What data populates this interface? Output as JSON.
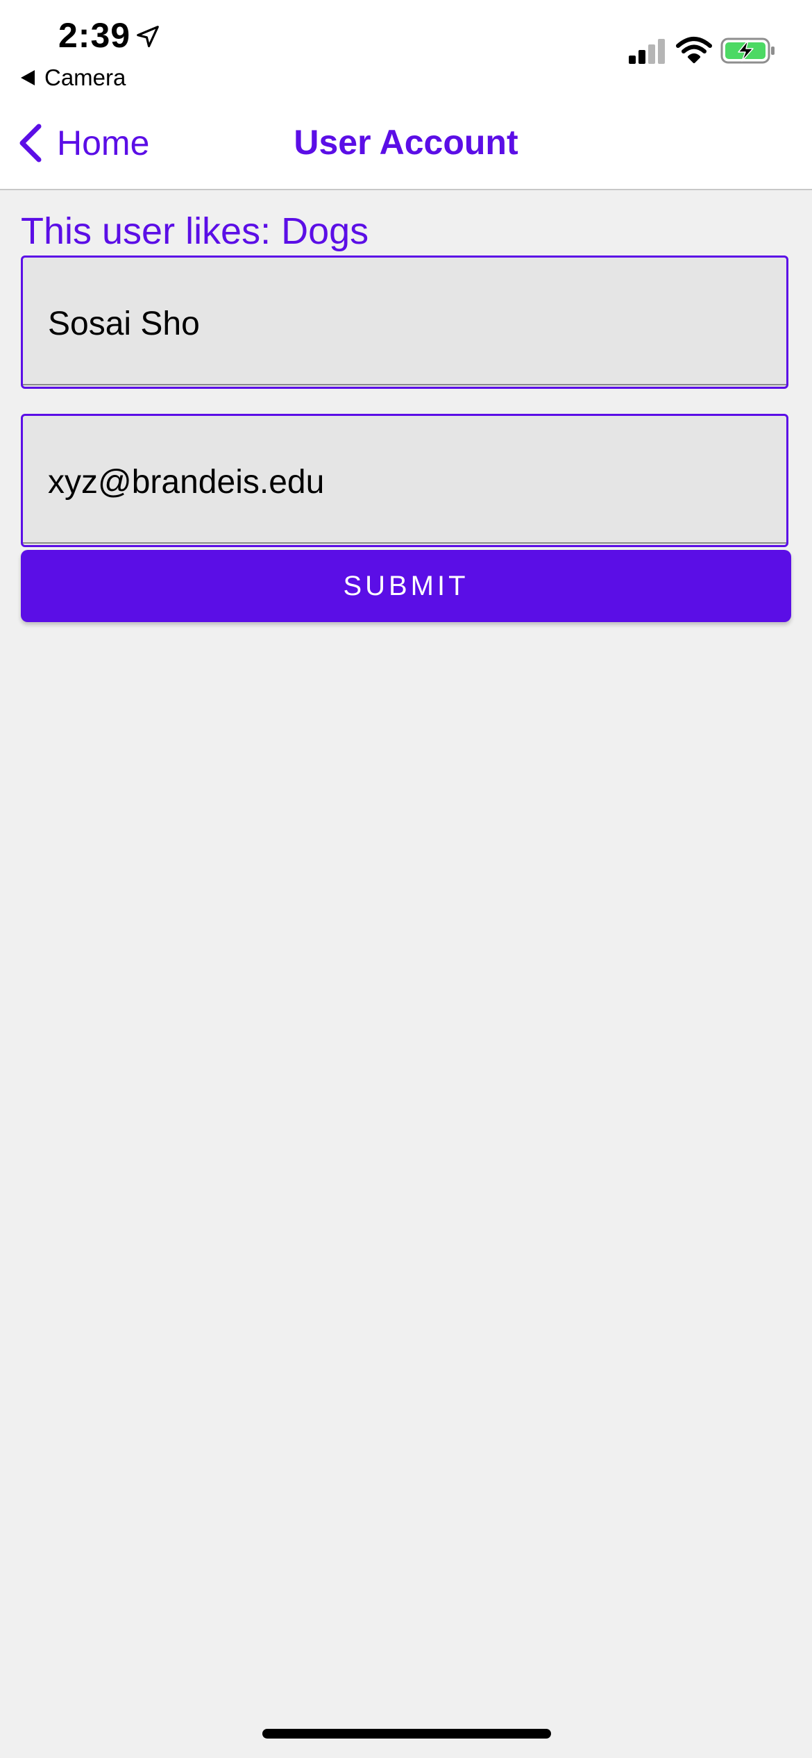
{
  "status_bar": {
    "time": "2:39",
    "back_app_label": "Camera",
    "icons": [
      "location-arrow-icon",
      "cellular-signal-icon",
      "wifi-icon",
      "battery-charging-icon"
    ],
    "battery_color": "#4cd964"
  },
  "nav": {
    "back_label": "Home",
    "title": "User Account"
  },
  "likes_text": "This user likes: Dogs",
  "form": {
    "name_value": "Sosai Sho",
    "email_value": "xyz@brandeis.edu",
    "submit_label": "SUBMIT"
  },
  "colors": {
    "accent": "#5b0ee6",
    "field_background": "#e5e5e5",
    "page_background": "#f0f0f0"
  }
}
